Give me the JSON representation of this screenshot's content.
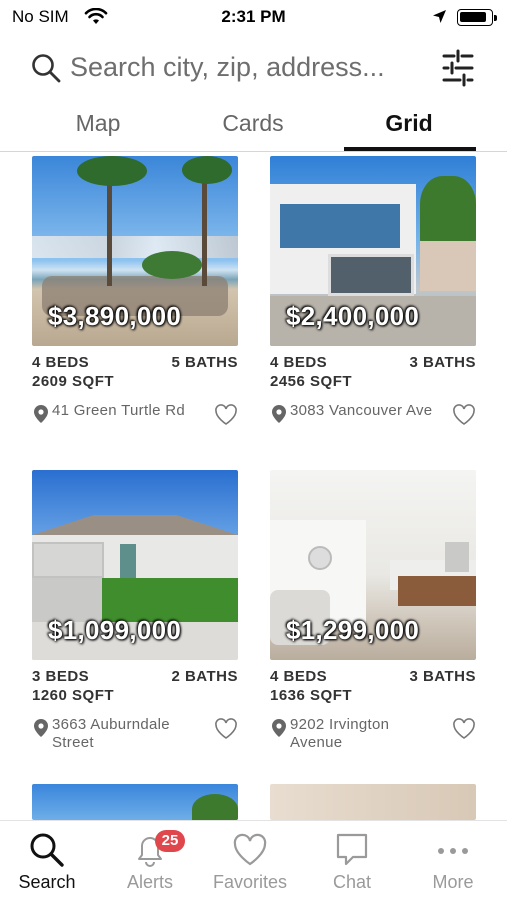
{
  "status_bar": {
    "carrier": "No SIM",
    "time": "2:31 PM"
  },
  "search": {
    "placeholder": "Search city, zip, address..."
  },
  "tabs": [
    {
      "label": "Map",
      "active": false
    },
    {
      "label": "Cards",
      "active": false
    },
    {
      "label": "Grid",
      "active": true
    }
  ],
  "listings": [
    {
      "price": "$3,890,000",
      "beds": "4 BEDS",
      "baths": "5 BATHS",
      "sqft": "2609 SQFT",
      "address": "41 Green Turtle Rd",
      "favorited": false
    },
    {
      "price": "$2,400,000",
      "beds": "4 BEDS",
      "baths": "3 BATHS",
      "sqft": "2456 SQFT",
      "address": "3083 Vancouver Ave",
      "favorited": false
    },
    {
      "price": "$1,099,000",
      "beds": "3 BEDS",
      "baths": "2 BATHS",
      "sqft": "1260 SQFT",
      "address": "3663 Auburndale Street",
      "favorited": false
    },
    {
      "price": "$1,299,000",
      "beds": "4 BEDS",
      "baths": "3 BATHS",
      "sqft": "1636 SQFT",
      "address": "9202 Irvington Avenue",
      "favorited": false
    }
  ],
  "bottom_nav": [
    {
      "label": "Search",
      "icon": "search-icon",
      "active": true
    },
    {
      "label": "Alerts",
      "icon": "bell-icon",
      "badge": "25",
      "active": false
    },
    {
      "label": "Favorites",
      "icon": "heart-icon",
      "active": false
    },
    {
      "label": "Chat",
      "icon": "chat-bubble-icon",
      "active": false
    },
    {
      "label": "More",
      "icon": "ellipsis-icon",
      "active": false
    }
  ],
  "colors": {
    "badge": "#e0474c",
    "active_text": "#111111",
    "inactive_text": "#9a9a9a"
  }
}
